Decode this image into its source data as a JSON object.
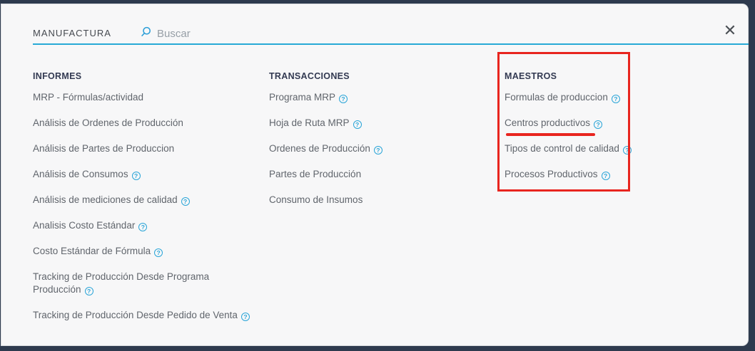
{
  "window": {
    "title": "MANUFACTURA",
    "close_glyph": "✕"
  },
  "search": {
    "placeholder": "Buscar",
    "value": ""
  },
  "menu": {
    "columns": [
      {
        "id": "informes",
        "header": "INFORMES",
        "items": [
          {
            "label": "MRP - Fórmulas/actividad",
            "help": false
          },
          {
            "label": "Análisis de Ordenes de Producción",
            "help": false
          },
          {
            "label": "Análisis de Partes de Produccion",
            "help": false
          },
          {
            "label": "Análisis de Consumos",
            "help": true
          },
          {
            "label": "Análisis de mediciones de calidad",
            "help": true
          },
          {
            "label": "Analisis Costo Estándar",
            "help": true
          },
          {
            "label": "Costo Estándar de Fórmula",
            "help": true
          },
          {
            "label": "Tracking de Producción Desde Programa Producción",
            "help": true,
            "wrap": true
          },
          {
            "label": "Tracking de Producción Desde Pedido de Venta",
            "help": true
          }
        ]
      },
      {
        "id": "transacciones",
        "header": "TRANSACCIONES",
        "items": [
          {
            "label": "Programa MRP",
            "help": true
          },
          {
            "label": "Hoja de Ruta MRP",
            "help": true
          },
          {
            "label": "Ordenes de Producción",
            "help": true
          },
          {
            "label": "Partes de Producción",
            "help": false
          },
          {
            "label": "Consumo de Insumos",
            "help": false
          }
        ]
      },
      {
        "id": "maestros",
        "header": "MAESTROS",
        "items": [
          {
            "label": "Formulas de produccion",
            "help": true
          },
          {
            "label": "Centros productivos",
            "help": true
          },
          {
            "label": "Tipos de control de calidad",
            "help": true
          },
          {
            "label": "Procesos Productivos",
            "help": true
          }
        ]
      }
    ]
  },
  "icons": {
    "help_glyph": "?",
    "search": "search-icon"
  },
  "annotations": {
    "highlighted_section": "MAESTROS",
    "underlined_item": "Centros productivos"
  },
  "colors": {
    "frame_navy": "#2e3a4e",
    "modal_bg": "#f7f7f8",
    "accent_teal": "#27a9d6",
    "annotation_red": "#e8251f",
    "header_text": "#333a52",
    "item_text": "#60656c",
    "placeholder_text": "#969ea6"
  }
}
